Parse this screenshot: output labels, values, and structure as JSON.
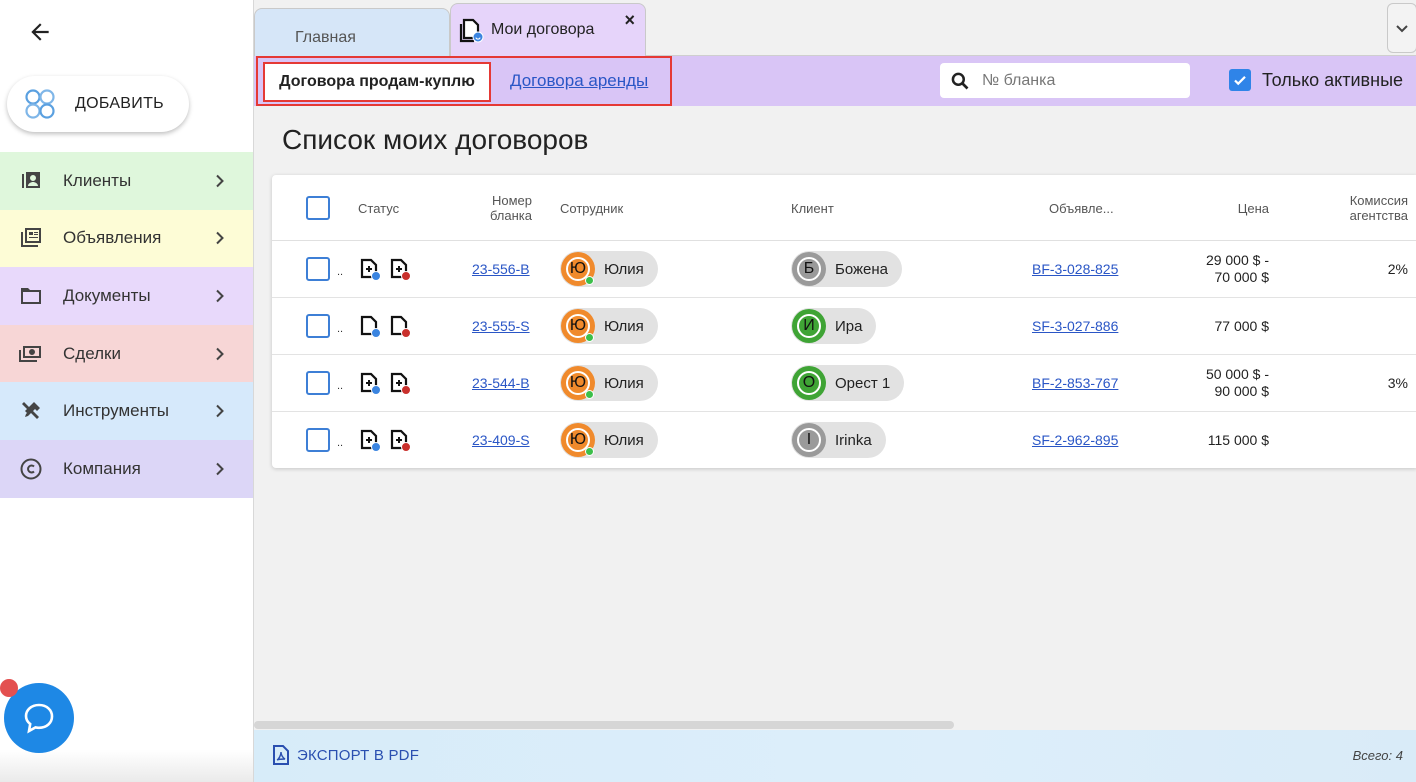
{
  "sidebar": {
    "add_label": "ДОБАВИТЬ",
    "items": [
      {
        "label": "Клиенты",
        "icon": "contact-card-icon",
        "color": "#dff7dc"
      },
      {
        "label": "Объявления",
        "icon": "ads-icon",
        "color": "#fdfcd6"
      },
      {
        "label": "Документы",
        "icon": "folder-icon",
        "color": "#e8d9fb"
      },
      {
        "label": "Сделки",
        "icon": "money-icon",
        "color": "#f7d6d6"
      },
      {
        "label": "Инструменты",
        "icon": "tools-icon",
        "color": "#d6e9fb"
      },
      {
        "label": "Компания",
        "icon": "copyright-icon",
        "color": "#dcd6f7"
      }
    ]
  },
  "tabs": {
    "home": "Главная",
    "contracts": "Мои договора",
    "close": "×"
  },
  "toolbar": {
    "subtab_sale": "Договора продам-куплю",
    "subtab_rent": "Договора аренды",
    "search_placeholder": "№ бланка",
    "active_only": "Только активные",
    "active_only_checked": true
  },
  "page_title": "Список моих договоров",
  "table": {
    "headers": {
      "status": "Статус",
      "form_no_1": "Номер",
      "form_no_2": "бланка",
      "employee": "Сотрудник",
      "client": "Клиент",
      "ad": "Объявле...",
      "price": "Цена",
      "commission_1": "Комиссия",
      "commission_2": "агентства"
    },
    "rows": [
      {
        "dots": "..",
        "form_no": "23-556-B",
        "employee_initial": "Ю",
        "employee": "Юлия",
        "client_initial": "Б",
        "client": "Божена",
        "client_color": "#9a9a9a",
        "ad": "BF-3-028-825",
        "price_1": "29 000 $ -",
        "price_2": "70 000 $",
        "commission": "2%"
      },
      {
        "dots": "..",
        "form_no": "23-555-S",
        "employee_initial": "Ю",
        "employee": "Юлия",
        "client_initial": "И",
        "client": "Ира",
        "client_color": "#3fa435",
        "ad": "SF-3-027-886",
        "price_1": "77 000 $",
        "price_2": "",
        "commission": ""
      },
      {
        "dots": "..",
        "form_no": "23-544-B",
        "employee_initial": "Ю",
        "employee": "Юлия",
        "client_initial": "О",
        "client": "Орест 1",
        "client_color": "#3fa435",
        "ad": "BF-2-853-767",
        "price_1": "50 000 $ -",
        "price_2": "90 000 $",
        "commission": "3%"
      },
      {
        "dots": "..",
        "form_no": "23-409-S",
        "employee_initial": "Ю",
        "employee": "Юлия",
        "client_initial": "I",
        "client": "Irinka",
        "client_color": "#9a9a9a",
        "ad": "SF-2-962-895",
        "price_1": "115 000 $",
        "price_2": "",
        "commission": ""
      }
    ]
  },
  "footer": {
    "export": "ЭКСПОРТ В PDF",
    "total": "Всего: 4"
  },
  "colors": {
    "toolbar_bg": "#d9c5f6",
    "accent_blue": "#2f84e8",
    "highlight_red": "#e53935",
    "employee_avatar": "#f08a2c"
  }
}
